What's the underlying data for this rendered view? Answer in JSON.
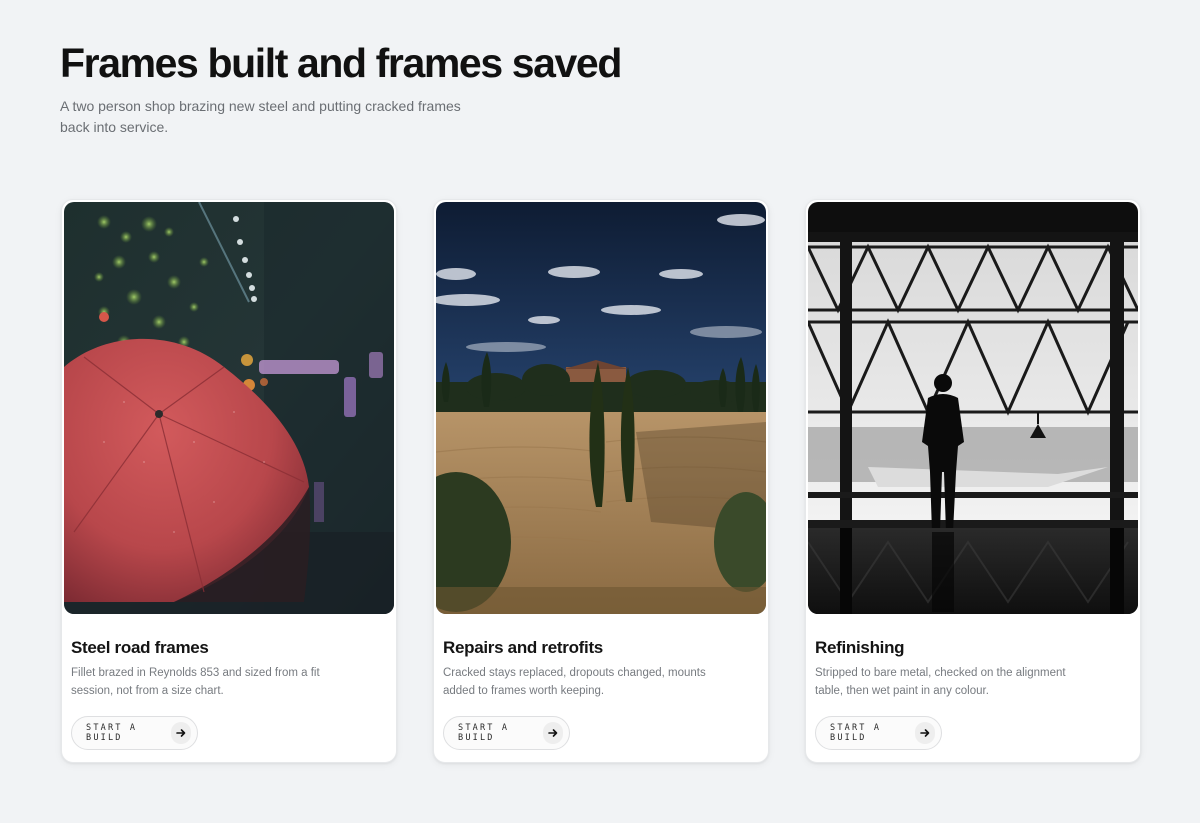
{
  "header": {
    "title": "Frames built and frames saved",
    "subtitle": "A two person shop brazing new steel and putting cracked frames back into service."
  },
  "cards": [
    {
      "title": "Steel road frames",
      "description": "Fillet brazed in Reynolds 853 and sized from a fit session, not from a size chart.",
      "cta_label": "START A BUILD",
      "cta_icon": "arrow-right-icon",
      "image": "red-umbrella-night-street-photo"
    },
    {
      "title": "Repairs and retrofits",
      "description": "Cracked stays replaced, dropouts changed, mounts added to frames worth keeping.",
      "cta_label": "START A BUILD",
      "cta_icon": "arrow-right-icon",
      "image": "tuscan-hill-cypress-photo"
    },
    {
      "title": "Refinishing",
      "description": "Stripped to bare metal, checked on the alignment table, then wet paint in any colour.",
      "cta_label": "START A BUILD",
      "cta_icon": "arrow-right-icon",
      "image": "silhouette-hangar-window-photo"
    }
  ],
  "colors": {
    "background": "#f1f3f5",
    "card": "#ffffff",
    "heading": "#111111",
    "muted_text": "#6a6e73",
    "button_border": "#dedfe1"
  }
}
